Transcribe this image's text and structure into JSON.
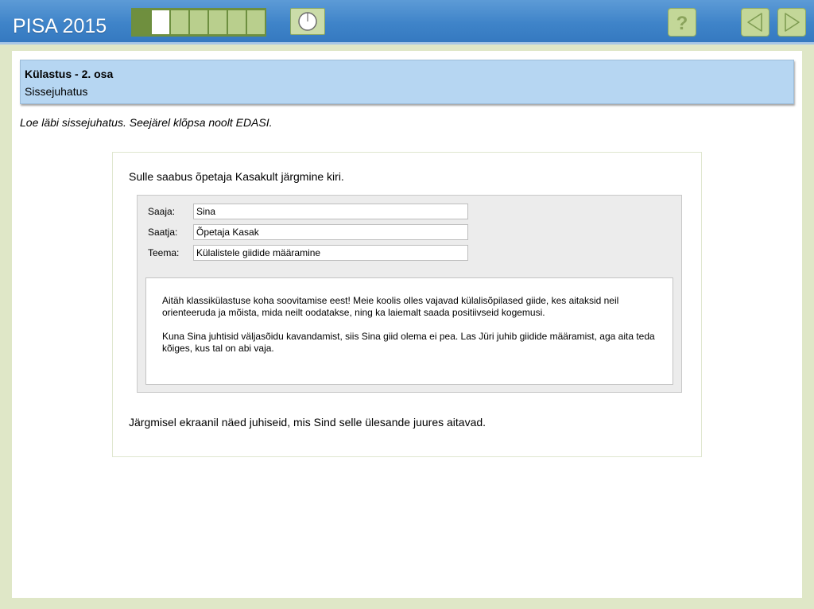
{
  "header": {
    "app_title": "PISA 2015",
    "progress": {
      "total": 7,
      "done": 1,
      "current": 2
    },
    "icons": {
      "timer": "clock-icon",
      "help": "help-icon",
      "back": "arrow-left-icon",
      "next": "arrow-right-icon"
    },
    "help_glyph": "?"
  },
  "task": {
    "title": "Külastus - 2. osa",
    "subtitle": "Sissejuhatus"
  },
  "instruction": "Loe läbi sissejuhatus. Seejärel klõpsa noolt EDASI.",
  "content": {
    "intro": "Sulle saabus õpetaja Kasakult järgmine kiri.",
    "email": {
      "fields": [
        {
          "label": "Saaja:",
          "value": "Sina"
        },
        {
          "label": "Saatja:",
          "value": "Õpetaja Kasak"
        },
        {
          "label": "Teema:",
          "value": "Külalistele giidide määramine"
        }
      ],
      "body": [
        "Aitäh klassikülastuse koha soovitamise eest! Meie koolis olles vajavad külalisõpilased giide, kes aitaksid neil orienteeruda ja mõista, mida neilt oodatakse, ning ka laiemalt saada positiivseid kogemusi.",
        "Kuna Sina juhtisid väljasõidu kavandamist, siis Sina giid olema ei pea. Las Jüri juhib giidide määramist, aga aita teda kõiges, kus tal on abi vaja."
      ]
    },
    "outro": "Järgmisel ekraanil näed juhiseid, mis Sind selle ülesande juures aitavad."
  },
  "colors": {
    "topbar": "#3f84c9",
    "header_band": "#b6d6f2",
    "button_green": "#c3d798",
    "progress_done": "#6f8f3e"
  }
}
